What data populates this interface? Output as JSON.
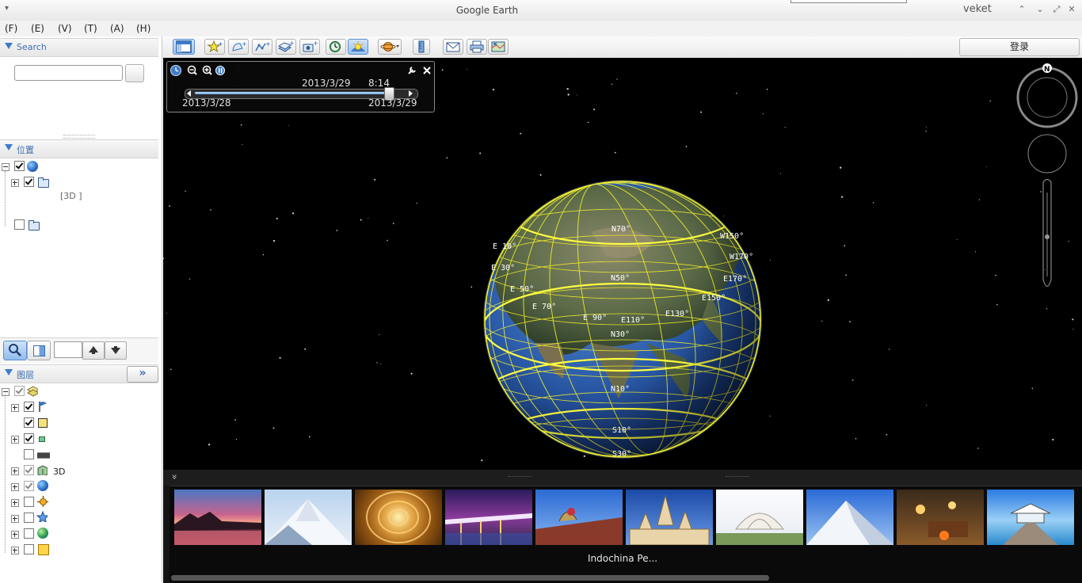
{
  "window": {
    "title": "Google Earth",
    "user": "veket",
    "menu_icon": "▾",
    "minimize_label": "⌃",
    "restore_label": "⌄",
    "maximize_label": "⤢",
    "close_label": "✕"
  },
  "menu": {
    "items": [
      "(F)",
      "(E)",
      "(V)",
      "(T)",
      "(A)",
      "(H)"
    ]
  },
  "search": {
    "header": "Search",
    "input_value": "",
    "button_label": ""
  },
  "places": {
    "header": "位置",
    "sub_label": "[3D ]"
  },
  "panel_controls": {
    "input_value": ""
  },
  "layers": {
    "header": "图层",
    "expand_label": "»",
    "item_3d_label": "3D"
  },
  "toolbar": {
    "login_label": "登录"
  },
  "time_slider": {
    "current_date": "2013/3/29",
    "current_time": "8:14",
    "start_date": "2013/3/28",
    "end_date": "2013/3/29",
    "position": 0.93
  },
  "globe": {
    "grid_labels": [
      "N70°",
      "N50°",
      "N30°",
      "N10°",
      "S10°",
      "S30°",
      "E 90°",
      "E110°",
      "E130°",
      "E150°",
      "E170°",
      "W170°",
      "W150°",
      "E 70°",
      "E 50°",
      "E 30°",
      "E 10°"
    ]
  },
  "navigation": {
    "north_label": "N"
  },
  "tours": {
    "caption": "Indochina Pe...",
    "collapse_label": "»"
  },
  "colors": {
    "accent": "#3d7cc9",
    "grid_line": "#f2ef2a",
    "space": "#000000"
  }
}
